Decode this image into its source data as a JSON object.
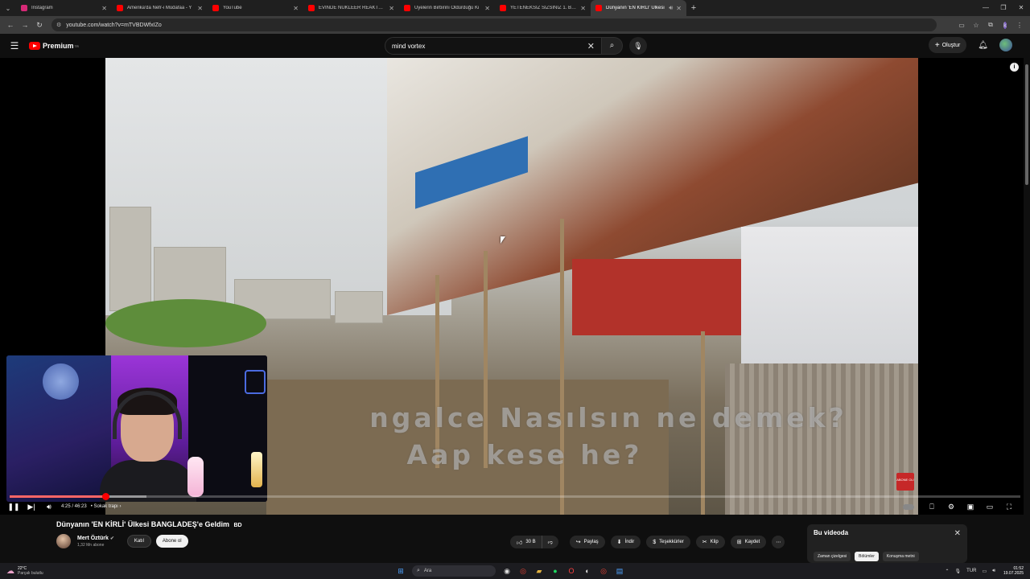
{
  "browser": {
    "tabs": [
      {
        "label": "Instagram",
        "color": "#d62976",
        "active": false
      },
      {
        "label": "Amerika'da Nefr-i Müdafaa - Y",
        "color": "#ff0000",
        "active": false
      },
      {
        "label": "YouTube",
        "color": "#ff0000",
        "active": false
      },
      {
        "label": "EVİNDE NÜKLEER REAKTÖR YA",
        "color": "#ff0000",
        "active": false
      },
      {
        "label": "Üyelerin Birbirini Öldürdüğü Ki",
        "color": "#ff0000",
        "active": false
      },
      {
        "label": "YETENEKSİZ SIZSINIZ 1. BÖLÜ",
        "color": "#ff0000",
        "active": false
      },
      {
        "label": "Dünyanın 'EN KİRLİ' Ülkesi",
        "color": "#ff0000",
        "active": true
      }
    ],
    "url": "youtube.com/watch?v=mTVBDWfxIZo"
  },
  "header": {
    "logo": "Premium",
    "logo_sup": "TR",
    "search_value": "mind vortex",
    "create_label": "Oluştur"
  },
  "video": {
    "subtitle_line1": "ngalce  Nasılsın  ne demek?",
    "subtitle_line2": "Aap kese he?",
    "badge_text": "ABONE OL!",
    "time": "4:25 / 46:23",
    "chapter": "Sokak trapı",
    "progress_fraction": 0.095
  },
  "meta": {
    "title": "Dünyanın 'EN KİRLİ' Ülkesi BANGLADEŞ'e Geldim",
    "title_flag": "BD",
    "channel": "Mert Öztürk",
    "subs": "1,32 Mn abone",
    "join_label": "Katıl",
    "subscribe_label": "Abone ol",
    "like_count": "30 B",
    "share_label": "Paylaş",
    "download_label": "İndir",
    "thanks_label": "Teşekkürler",
    "clip_label": "Klip",
    "save_label": "Kaydet"
  },
  "side_panel": {
    "title": "Bu videoda",
    "chips": [
      "Zaman çizelgesi",
      "Bölümler",
      "Konuşma metni"
    ],
    "active_chip": 1
  },
  "taskbar": {
    "temp": "22°C",
    "weather": "Parçalı bulutlu",
    "search": "Ara",
    "lang": "TUR",
    "time": "01:52",
    "date": "19.07.2025"
  }
}
